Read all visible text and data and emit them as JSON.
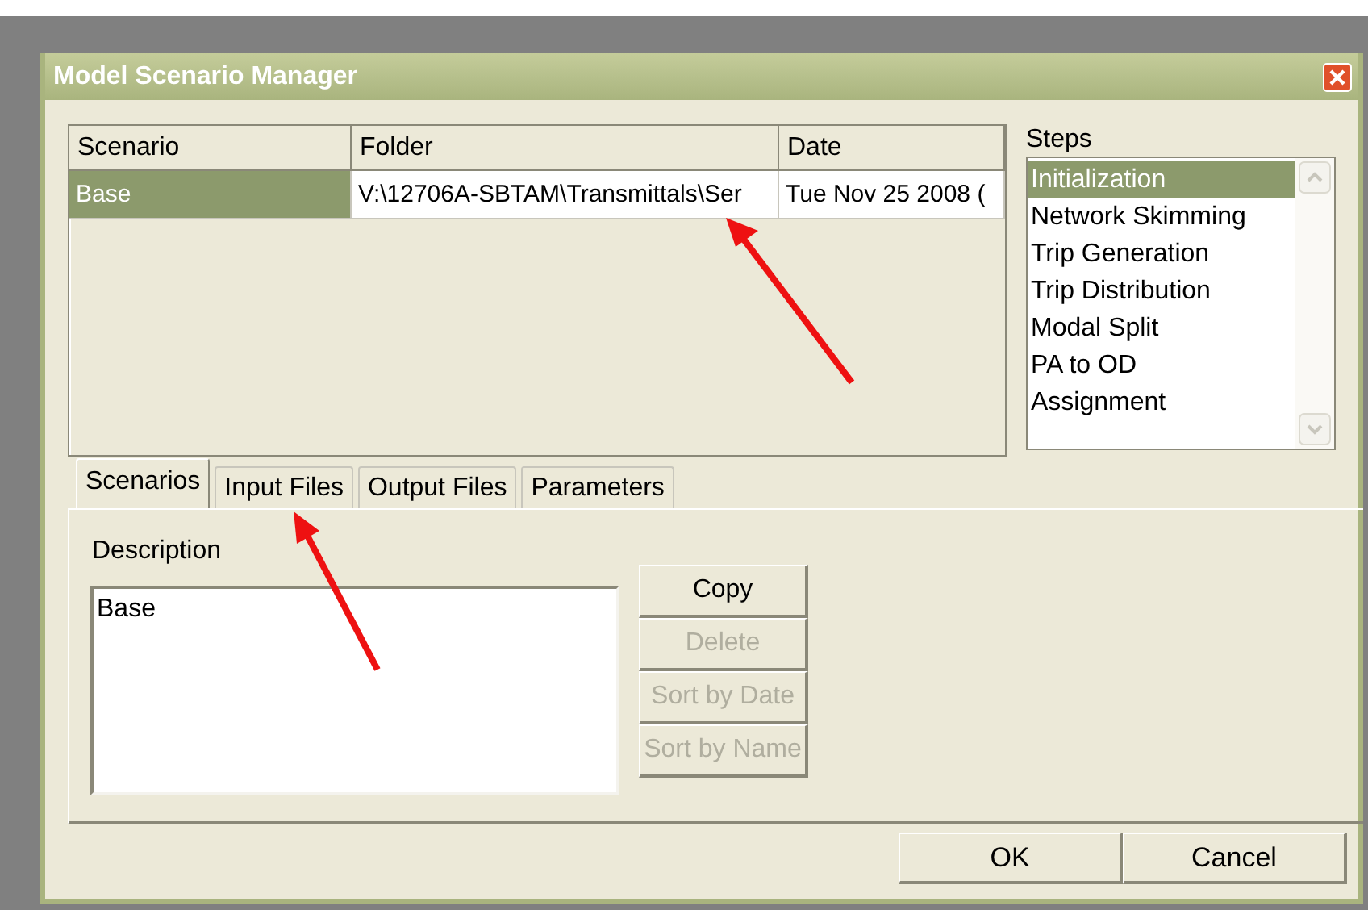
{
  "window": {
    "title": "Model Scenario Manager"
  },
  "scenario_table": {
    "columns": [
      "Scenario",
      "Folder",
      "Date"
    ],
    "rows": [
      {
        "scenario": "Base",
        "folder": "V:\\12706A-SBTAM\\Transmittals\\Ser",
        "date": "Tue Nov 25 2008 (",
        "selected": true
      }
    ]
  },
  "steps": {
    "label": "Steps",
    "items": [
      {
        "label": "Initialization",
        "selected": true
      },
      {
        "label": "Network Skimming",
        "selected": false
      },
      {
        "label": "Trip Generation",
        "selected": false
      },
      {
        "label": "Trip Distribution",
        "selected": false
      },
      {
        "label": "Modal Split",
        "selected": false
      },
      {
        "label": "PA to OD",
        "selected": false
      },
      {
        "label": "Assignment",
        "selected": false
      }
    ]
  },
  "tabs": [
    {
      "label": "Scenarios",
      "selected": true
    },
    {
      "label": "Input Files",
      "selected": false
    },
    {
      "label": "Output Files",
      "selected": false
    },
    {
      "label": "Parameters",
      "selected": false
    }
  ],
  "description": {
    "label": "Description",
    "value": "Base"
  },
  "side_buttons": [
    {
      "label": "Copy",
      "disabled": false
    },
    {
      "label": "Delete",
      "disabled": true
    },
    {
      "label": "Sort by Date",
      "disabled": true
    },
    {
      "label": "Sort by Name",
      "disabled": true
    }
  ],
  "dialog_buttons": [
    "OK",
    "Cancel"
  ]
}
